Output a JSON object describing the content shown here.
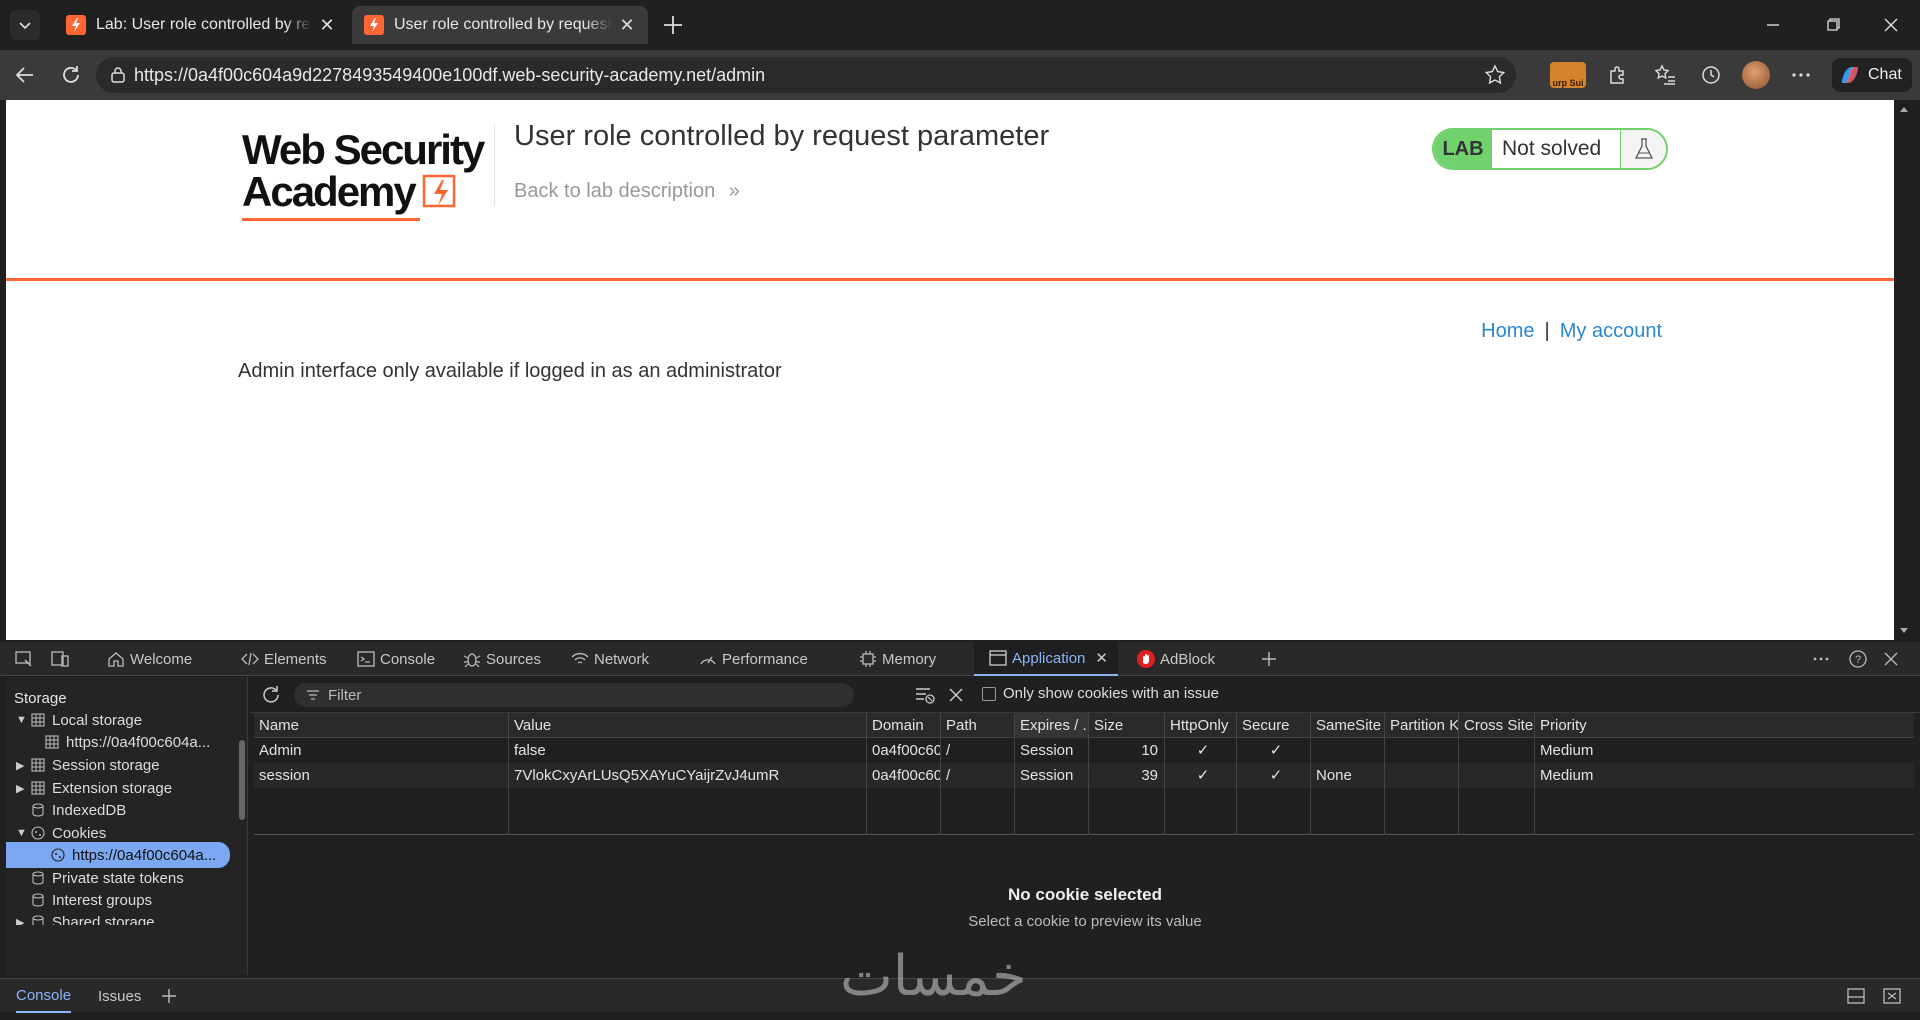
{
  "browser": {
    "tabs": [
      {
        "title": "Lab: User role controlled by request parameter",
        "active": false
      },
      {
        "title": "User role controlled by request parameter",
        "active": true
      }
    ],
    "url": "https://0a4f00c604a9d2278493549400e100df.web-security-academy.net/admin",
    "chat_label": "Chat",
    "extension_badge": "urp Sui"
  },
  "page": {
    "logo_line1": "Web Security",
    "logo_line2": "Academy",
    "lab_title": "User role controlled by request parameter",
    "back_link": "Back to lab description",
    "badge_lab": "LAB",
    "badge_state": "Not solved",
    "nav_home": "Home",
    "nav_sep": "|",
    "nav_account": "My account",
    "admin_message": "Admin interface only available if logged in as an administrator"
  },
  "devtools": {
    "tabs": [
      {
        "label": "Welcome",
        "icon": "home-icon"
      },
      {
        "label": "Elements",
        "icon": "code-icon"
      },
      {
        "label": "Console",
        "icon": "console-icon"
      },
      {
        "label": "Sources",
        "icon": "bug-icon"
      },
      {
        "label": "Network",
        "icon": "wifi-icon"
      },
      {
        "label": "Performance",
        "icon": "gauge-icon"
      },
      {
        "label": "Memory",
        "icon": "chip-icon"
      },
      {
        "label": "Application",
        "icon": "window-icon",
        "active": true
      },
      {
        "label": "AdBlock",
        "icon": "adblock-icon"
      }
    ],
    "sidebar": {
      "heading": "Storage",
      "items": [
        {
          "label": "Local storage"
        },
        {
          "label": "https://0a4f00c604a..."
        },
        {
          "label": "Session storage"
        },
        {
          "label": "Extension storage"
        },
        {
          "label": "IndexedDB"
        },
        {
          "label": "Cookies"
        },
        {
          "label": "https://0a4f00c604a...",
          "selected": true
        },
        {
          "label": "Private state tokens"
        },
        {
          "label": "Interest groups"
        },
        {
          "label": "Shared storage"
        }
      ]
    },
    "filter_placeholder": "Filter",
    "only_issues_label": "Only show cookies with an issue",
    "cookie_columns": [
      "Name",
      "Value",
      "Domain",
      "Path",
      "Expires / ...",
      "Size",
      "HttpOnly",
      "Secure",
      "SameSite",
      "Partition K...",
      "Cross Site",
      "Priority"
    ],
    "cookies": [
      {
        "name": "Admin",
        "value": "false",
        "domain": "0a4f00c60...",
        "path": "/",
        "expires": "Session",
        "size": "10",
        "httponly": "✓",
        "secure": "✓",
        "samesite": "",
        "partition": "",
        "cross_site": "",
        "priority": "Medium"
      },
      {
        "name": "session",
        "value": "7VlokCxyArLUsQ5XAYuCYaijrZvJ4umR",
        "domain": "0a4f00c60...",
        "path": "/",
        "expires": "Session",
        "size": "39",
        "httponly": "✓",
        "secure": "✓",
        "samesite": "None",
        "partition": "",
        "cross_site": "",
        "priority": "Medium"
      }
    ],
    "preview_title": "No cookie selected",
    "preview_subtitle": "Select a cookie to preview its value",
    "drawer_tabs": [
      {
        "label": "Console",
        "active": true
      },
      {
        "label": "Issues"
      }
    ]
  },
  "watermark": "خمسات",
  "colors": {
    "accent_orange": "#ff6633",
    "lab_green": "#70d16d",
    "link_blue": "#2a88d0",
    "devtools_accent": "#8ab4f8"
  }
}
